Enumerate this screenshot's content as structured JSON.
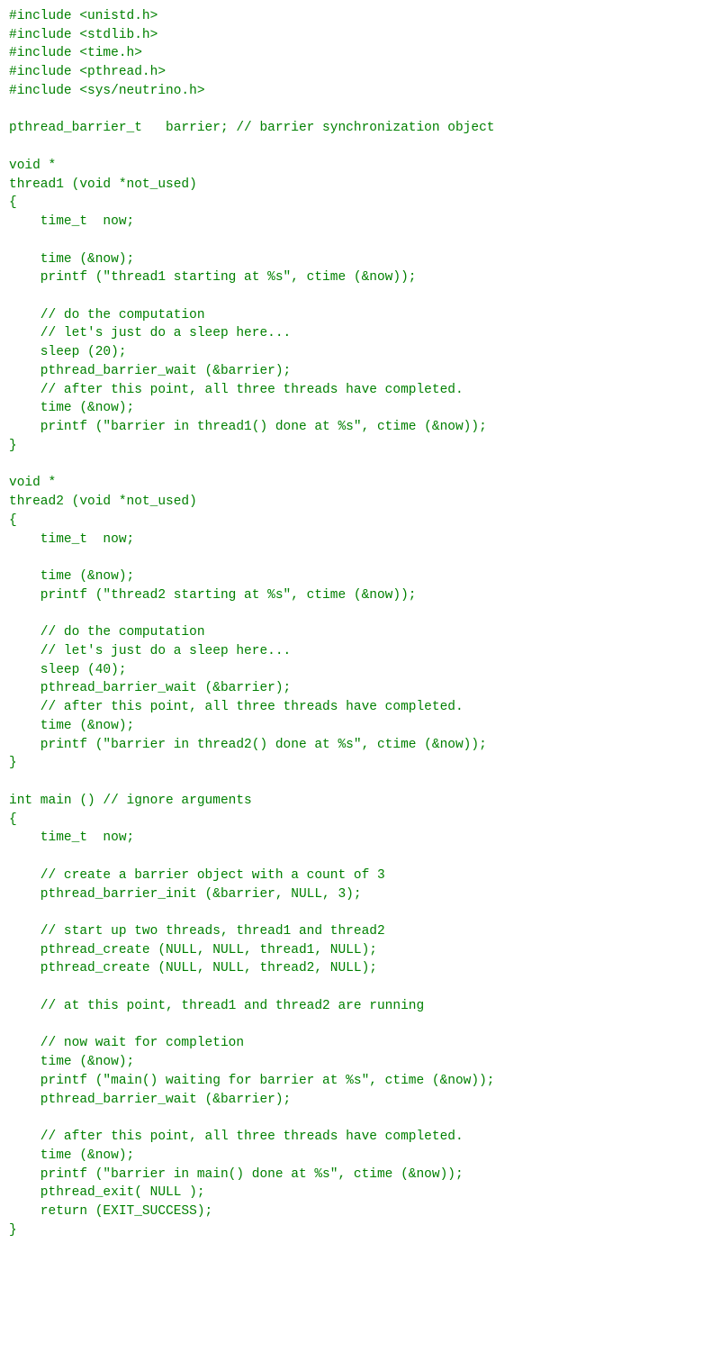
{
  "code_lines": [
    "#include <unistd.h>",
    "#include <stdlib.h>",
    "#include <time.h>",
    "#include <pthread.h>",
    "#include <sys/neutrino.h>",
    "",
    "pthread_barrier_t   barrier; // barrier synchronization object",
    "",
    "void *",
    "thread1 (void *not_used)",
    "{",
    "    time_t  now;",
    "",
    "    time (&now);",
    "    printf (\"thread1 starting at %s\", ctime (&now));",
    "",
    "    // do the computation",
    "    // let's just do a sleep here...",
    "    sleep (20);",
    "    pthread_barrier_wait (&barrier);",
    "    // after this point, all three threads have completed.",
    "    time (&now);",
    "    printf (\"barrier in thread1() done at %s\", ctime (&now));",
    "}",
    "",
    "void *",
    "thread2 (void *not_used)",
    "{",
    "    time_t  now;",
    "",
    "    time (&now);",
    "    printf (\"thread2 starting at %s\", ctime (&now));",
    "",
    "    // do the computation",
    "    // let's just do a sleep here...",
    "    sleep (40);",
    "    pthread_barrier_wait (&barrier);",
    "    // after this point, all three threads have completed.",
    "    time (&now);",
    "    printf (\"barrier in thread2() done at %s\", ctime (&now));",
    "}",
    "",
    "int main () // ignore arguments",
    "{",
    "    time_t  now;",
    "",
    "    // create a barrier object with a count of 3",
    "    pthread_barrier_init (&barrier, NULL, 3);",
    "",
    "    // start up two threads, thread1 and thread2",
    "    pthread_create (NULL, NULL, thread1, NULL);",
    "    pthread_create (NULL, NULL, thread2, NULL);",
    "",
    "    // at this point, thread1 and thread2 are running",
    "",
    "    // now wait for completion",
    "    time (&now);",
    "    printf (\"main() waiting for barrier at %s\", ctime (&now));",
    "    pthread_barrier_wait (&barrier);",
    "",
    "    // after this point, all three threads have completed.",
    "    time (&now);",
    "    printf (\"barrier in main() done at %s\", ctime (&now));",
    "    pthread_exit( NULL );",
    "    return (EXIT_SUCCESS);",
    "}"
  ]
}
